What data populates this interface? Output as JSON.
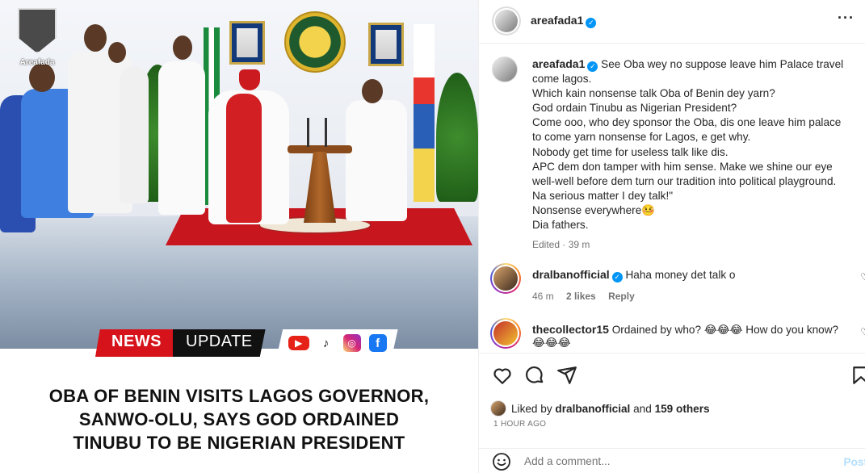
{
  "media": {
    "watermark": "Areafada",
    "news_label": "NEWS",
    "update_label": "UPDATE",
    "social_icons": [
      "youtube-icon",
      "tiktok-icon",
      "instagram-icon",
      "facebook-icon"
    ],
    "headline_lines": [
      "OBA OF BENIN VISITS LAGOS GOVERNOR,",
      "SANWO-OLU, SAYS GOD ORDAINED",
      "TINUBU TO BE NIGERIAN PRESIDENT"
    ],
    "colors": {
      "news_red": "#d6121a",
      "update_black": "#111111"
    }
  },
  "post": {
    "username": "areafada1",
    "more_label": "···",
    "caption_lines": [
      "See Oba wey no suppose leave him Palace travel",
      "come lagos.",
      "Which kain nonsense talk Oba of Benin dey yarn?",
      "God ordain Tinubu as Nigerian President?",
      "Come ooo, who dey sponsor the Oba, dis one leave him palace",
      "to come yarn nonsense for Lagos, e get why.",
      "Nobody get time for useless talk like dis.",
      "APC dem don tamper with him sense. Make we shine our eye",
      "well-well before dem turn our tradition into political playground.",
      "Na serious matter I dey talk!\"",
      "Nonsense everywhere🤒",
      "Dia fathers."
    ],
    "edited": "Edited · 39 m"
  },
  "comments": [
    {
      "username": "dralbanofficial",
      "verified": true,
      "text": "Haha money det talk o",
      "time": "46 m",
      "likes": "2 likes",
      "reply": "Reply"
    },
    {
      "username": "thecollector15",
      "verified": false,
      "text": "Ordained by who? 😂😂😂 How do you know?",
      "text2": "😂😂😂"
    }
  ],
  "footer": {
    "liked_by_prefix": "Liked by ",
    "liked_by_user": "dralbanofficial",
    "liked_by_mid": " and ",
    "liked_by_count": "159 others",
    "timestamp": "1 HOUR AGO",
    "comment_placeholder": "Add a comment...",
    "post_label": "Post"
  }
}
